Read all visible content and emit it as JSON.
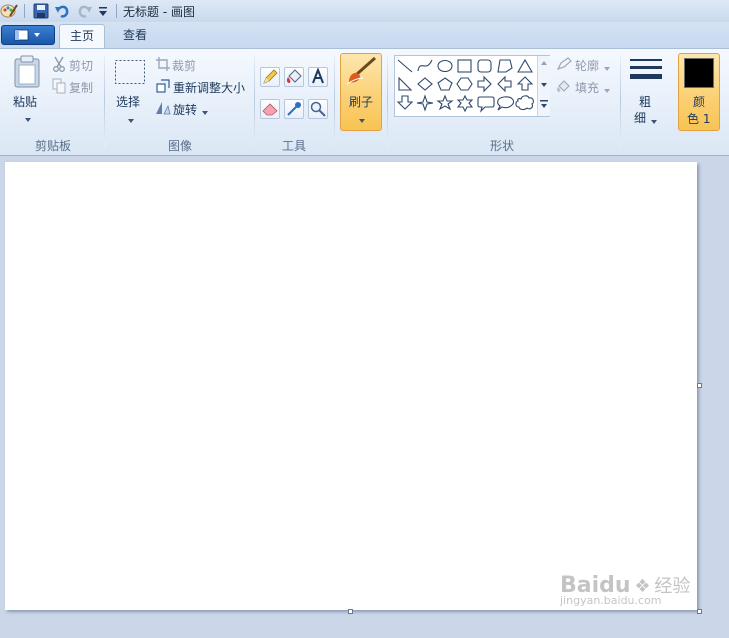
{
  "window": {
    "title": "无标题 - 画图"
  },
  "tabs": [
    {
      "label": "主页",
      "active": true
    },
    {
      "label": "查看",
      "active": false
    }
  ],
  "clipboard": {
    "paste_label": "粘贴",
    "cut_label": "剪切",
    "copy_label": "复制",
    "group_label": "剪贴板"
  },
  "image": {
    "select_label": "选择",
    "crop_label": "裁剪",
    "resize_label": "重新调整大小",
    "rotate_label": "旋转",
    "group_label": "图像"
  },
  "tools": {
    "group_label": "工具"
  },
  "brushes": {
    "label": "刷子"
  },
  "shapes": {
    "outline_label": "轮廓",
    "fill_label": "填充",
    "group_label": "形状"
  },
  "size": {
    "label_line1": "粗",
    "label_line2": "细"
  },
  "color1": {
    "label_line1": "颜",
    "label_line2": "色 1",
    "value": "#000000"
  },
  "colors": {
    "accent_orange": "#fbd176",
    "ribbon_bg": "#e5eef9",
    "workspace_bg": "#cbd7e8"
  },
  "watermark": {
    "brand": "Baidu",
    "brand_cn": "经验",
    "url": "jingyan.baidu.com"
  }
}
